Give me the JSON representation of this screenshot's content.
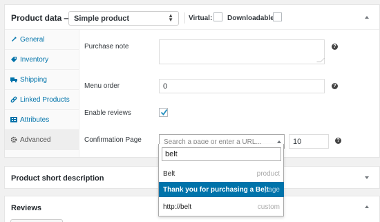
{
  "product_data": {
    "title": "Product data —",
    "type_select": {
      "value": "Simple product"
    },
    "virtual_label": "Virtual:",
    "downloadable_label": "Downloadable:"
  },
  "tabs": [
    {
      "label": "General",
      "icon": "wrench-icon"
    },
    {
      "label": "Inventory",
      "icon": "tag-icon"
    },
    {
      "label": "Shipping",
      "icon": "truck-icon"
    },
    {
      "label": "Linked Products",
      "icon": "link-icon"
    },
    {
      "label": "Attributes",
      "icon": "list-icon"
    },
    {
      "label": "Advanced",
      "icon": "gear-icon"
    }
  ],
  "fields": {
    "purchase_note": {
      "label": "Purchase note",
      "value": ""
    },
    "menu_order": {
      "label": "Menu order",
      "value": "0"
    },
    "enable_reviews": {
      "label": "Enable reviews",
      "checked": true
    },
    "confirmation_page": {
      "label": "Confirmation Page",
      "placeholder": "Search a page or enter a URL...",
      "number_value": "10"
    }
  },
  "dropdown": {
    "search_value": "belt",
    "options": [
      {
        "title": "Belt",
        "kind": "product",
        "highlighted": false
      },
      {
        "title": "Thank you for purchasing a Belt",
        "kind": "page",
        "highlighted": true
      },
      {
        "title": "http://belt",
        "kind": "custom",
        "highlighted": false
      }
    ]
  },
  "short_description": {
    "title": "Product short description"
  },
  "reviews": {
    "title": "Reviews"
  },
  "colors": {
    "link": "#0073aa",
    "highlight": "#0073aa",
    "help": "#444444"
  }
}
